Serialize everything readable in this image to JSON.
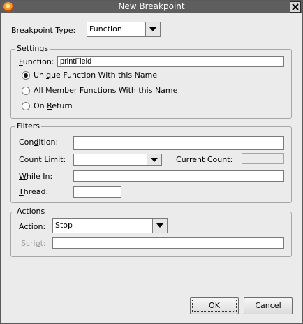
{
  "window": {
    "title": "New Breakpoint"
  },
  "breakpoint_type": {
    "label_pre": "",
    "label_accel": "B",
    "label_post": "reakpoint Type:",
    "value": "Function"
  },
  "settings": {
    "legend": "Settings",
    "function_label_accel": "F",
    "function_label_post": "unction:",
    "function_value": "printField",
    "radios": [
      {
        "pre": "Uni",
        "accel": "q",
        "post": "ue Function With this Name",
        "selected": true
      },
      {
        "pre": "",
        "accel": "A",
        "post": "ll Member Functions With this Name",
        "selected": false
      },
      {
        "pre": "On ",
        "accel": "R",
        "post": "eturn",
        "selected": false
      }
    ]
  },
  "filters": {
    "legend": "Filters",
    "condition_pre": "Con",
    "condition_accel": "d",
    "condition_post": "ition:",
    "condition_value": "",
    "count_limit_pre": "Co",
    "count_limit_accel": "u",
    "count_limit_post": "nt Limit:",
    "count_limit_value": "",
    "current_count_pre": "",
    "current_count_accel": "C",
    "current_count_post": "urrent Count:",
    "current_count_value": "",
    "while_in_pre": "",
    "while_in_accel": "W",
    "while_in_post": "hile In:",
    "while_in_value": "",
    "thread_pre": "",
    "thread_accel": "T",
    "thread_post": "hread:",
    "thread_value": ""
  },
  "actions": {
    "legend": "Actions",
    "action_pre": "Actio",
    "action_accel": "n",
    "action_post": ":",
    "action_value": "Stop",
    "script_pre": "Scri",
    "script_accel": "p",
    "script_post": "t:",
    "script_value": ""
  },
  "buttons": {
    "ok_accel": "O",
    "ok_post": "K",
    "cancel": "Cancel"
  },
  "colors": {
    "titlebar": "#5e5e5e",
    "dialog_bg": "#ebebeb"
  }
}
